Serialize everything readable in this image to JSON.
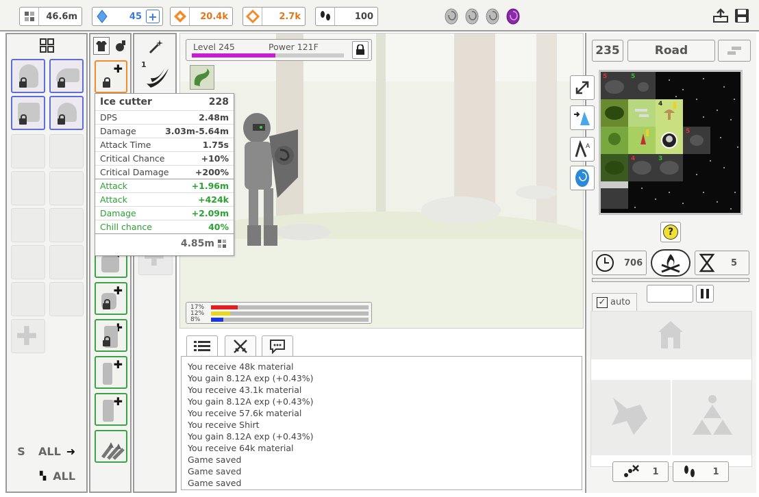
{
  "topbar": {
    "material": "46.6m",
    "gems": "45",
    "orange1": "20.4k",
    "orange2": "2.7k",
    "steps": "100"
  },
  "left_column": {
    "s_label": "S",
    "all_label": "ALL",
    "all_label2": "ALL"
  },
  "gear_column": {
    "skill_count": "1"
  },
  "scene": {
    "level": "Level 245",
    "power": "Power 121F",
    "bars": [
      {
        "label": "17%",
        "color": "#e02020",
        "fill": 0.17
      },
      {
        "label": "12%",
        "color": "#e8d820",
        "fill": 0.12
      },
      {
        "label": "8%",
        "color": "#1a3ad8",
        "fill": 0.08
      }
    ],
    "level_bar_fill": 0.55
  },
  "tooltip": {
    "name": "Ice cutter",
    "level": "228",
    "stats": [
      {
        "label": "DPS",
        "value": "2.48m",
        "green": false
      },
      {
        "label": "Damage",
        "value": "3.03m-5.64m",
        "green": false
      },
      {
        "label": "Attack Time",
        "value": "1.75s",
        "green": false
      },
      {
        "label": "Critical Chance",
        "value": "+10%",
        "green": false
      },
      {
        "label": "Critical Damage",
        "value": "+200%",
        "green": false
      },
      {
        "label": "Attack",
        "value": "+1.96m",
        "green": true
      },
      {
        "label": "Attack",
        "value": "+424k",
        "green": true
      },
      {
        "label": "Damage",
        "value": "+2.09m",
        "green": true
      },
      {
        "label": "Chill chance",
        "value": "40%",
        "green": true
      }
    ],
    "price": "4.85m"
  },
  "log": [
    "You receive 48k material",
    "You gain 8.12A exp (+0.43%)",
    "You receive 43.1k material",
    "You gain 8.12A exp (+0.43%)",
    "You receive 57.6k material",
    "You receive Shirt",
    "You gain 8.12A exp (+0.43%)",
    "You receive 64k material",
    "Game saved",
    "Game saved",
    "Game saved"
  ],
  "right_panel": {
    "zone_number": "235",
    "zone_name": "Road",
    "time_value": "706",
    "hourglass_value": "5",
    "auto_label": "auto",
    "help": "?",
    "bottom_left_value": "1",
    "bottom_right_value": "1",
    "map_numbers": {
      "a": "5",
      "b": "5",
      "c": "4",
      "d": "5",
      "e": "4",
      "f": "3"
    }
  },
  "colors": {
    "level_bar": "#c81ed2",
    "green_stat": "#2aa232",
    "slot_blue": "#5b6fd6",
    "slot_green": "#3ba345",
    "slot_orange": "#f08c2a"
  }
}
